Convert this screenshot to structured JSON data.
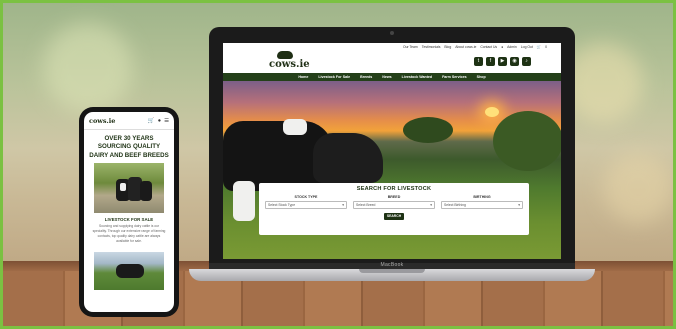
{
  "laptop": {
    "brand": "MacBook",
    "site": {
      "top_links": [
        "Our Team",
        "Testimonials",
        "Blog",
        "About cows.ie",
        "Contact Us",
        "Admin",
        "Log Out"
      ],
      "cart_count": "0",
      "logo_text": "cows.ie",
      "socials": [
        "twitter-icon",
        "facebook-icon",
        "youtube-icon",
        "instagram-icon",
        "tiktok-icon"
      ],
      "nav": [
        "Home",
        "Livestock For Sale",
        "Breeds",
        "News",
        "Livestock Wanted",
        "Farm Services",
        "Shop"
      ],
      "search": {
        "title": "SEARCH FOR LIVESTOCK",
        "columns": [
          {
            "label": "STOCK TYPE",
            "value": "Select Stock Type"
          },
          {
            "label": "BREED",
            "value": "Select Breed"
          },
          {
            "label": "BIRTHING",
            "value": "Select Birthing"
          }
        ],
        "button": "SEARCH"
      }
    }
  },
  "phone": {
    "logo_text": "cows.ie",
    "headline": "OVER 30 YEARS SOURCING QUALITY DAIRY AND BEEF BREEDS",
    "caption": "LIVESTOCK FOR SALE",
    "body": "Sourcing and supplying dairy cattle is our speciality. Through our extensive range of farming contacts, top quality dairy cattle are always available for sale."
  },
  "colors": {
    "frame": "#7bc142",
    "brand_green": "#1e3214",
    "nav_bg": "#24401a"
  }
}
